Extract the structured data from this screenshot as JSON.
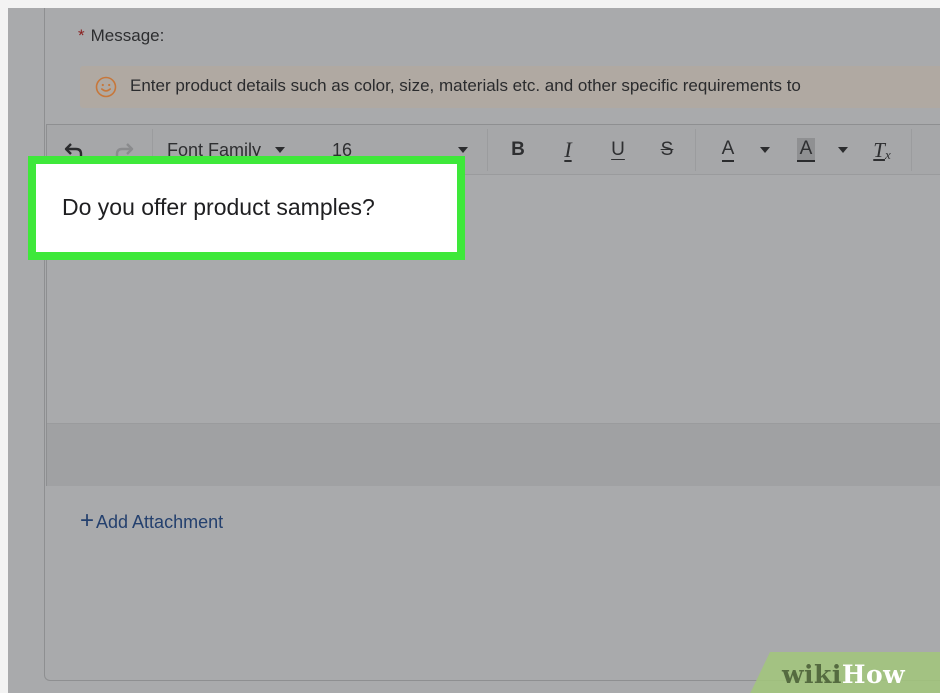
{
  "form": {
    "message_required_mark": "*",
    "message_label": "Message:",
    "hint_text": "Enter product details such as color, size, materials etc. and other specific requirements to"
  },
  "toolbar": {
    "undo_icon": "undo-icon",
    "redo_icon": "redo-icon",
    "font_family_label": "Font Family",
    "font_size_value": "16",
    "bold_label": "B",
    "italic_label": "I",
    "underline_label": "U",
    "strike_label": "S",
    "text_color_label": "A",
    "bg_color_label": "A",
    "clear_format_label": "T",
    "clear_format_sub": "x"
  },
  "editor": {
    "content": "Do you offer product samples?"
  },
  "attachment": {
    "plus": "+",
    "label": "Add Attachment"
  },
  "watermark": {
    "wiki": "wiki",
    "how": "How"
  },
  "colors": {
    "highlight_green": "#3ee83a",
    "link_blue": "#24406e",
    "hint_bg": "#b0a9a2",
    "hint_icon": "#d9822b"
  }
}
